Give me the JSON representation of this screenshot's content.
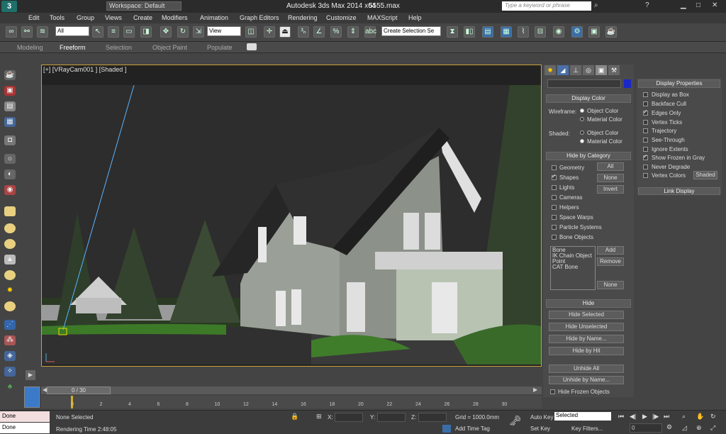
{
  "title": {
    "workspace": "Workspace: Default",
    "app": "Autodesk 3ds Max  2014 x64",
    "file": "5555.max",
    "search_placeholder": "Type a keyword or phrase"
  },
  "menu": [
    "Edit",
    "Tools",
    "Group",
    "Views",
    "Create",
    "Modifiers",
    "Animation",
    "Graph Editors",
    "Rendering",
    "Customize",
    "MAXScript",
    "Help"
  ],
  "toolbar": {
    "filter": "All",
    "view": "View",
    "selection_set": "Create Selection Se"
  },
  "ribbon": {
    "tabs": [
      "Modeling",
      "Freeform",
      "Selection",
      "Object Paint",
      "Populate"
    ]
  },
  "viewport": {
    "label": "[+] [VRayCam001 ] [Shaded ]"
  },
  "display_color": {
    "header": "Display Color",
    "wireframe": "Wireframe:",
    "shaded": "Shaded:",
    "object_color": "Object Color",
    "material_color": "Material Color"
  },
  "hide_by_category": {
    "header": "Hide by Category",
    "items": [
      "Geometry",
      "Shapes",
      "Lights",
      "Cameras",
      "Helpers",
      "Space Warps",
      "Particle Systems",
      "Bone Objects"
    ],
    "all": "All",
    "none": "None",
    "invert": "Invert",
    "list": [
      "Bone",
      "IK Chain Object",
      "Point",
      "CAT Bone"
    ],
    "add": "Add",
    "remove": "Remove",
    "none2": "None"
  },
  "hide": {
    "header": "Hide",
    "buttons": [
      "Hide Selected",
      "Hide Unselected",
      "Hide by Name...",
      "Hide by Hit",
      "Unhide All",
      "Unhide by Name..."
    ],
    "frozen": "Hide Frozen Objects"
  },
  "display_properties": {
    "header": "Display Properties",
    "items": [
      "Display as Box",
      "Backface Cull",
      "Edges Only",
      "Vertex Ticks",
      "Trajectory",
      "See-Through",
      "Ignore Extents",
      "Show Frozen in Gray",
      "Never Degrade",
      "Vertex Colors"
    ],
    "shaded_btn": "Shaded",
    "link_display": "Link Display"
  },
  "timeline": {
    "frame": "0 / 30",
    "ticks": [
      "0",
      "2",
      "4",
      "6",
      "8",
      "10",
      "12",
      "14",
      "16",
      "18",
      "20",
      "22",
      "24",
      "26",
      "28",
      "30"
    ]
  },
  "status": {
    "script_label": "Done",
    "script_value": "Done",
    "message": "None Selected",
    "rendering": "Rendering Time  2:48:05",
    "x": "X:",
    "y": "Y:",
    "z": "Z:",
    "grid": "Grid = 1000.0mm",
    "add_time_tag": "Add Time Tag",
    "auto_key": "Auto Key",
    "set_key": "Set Key",
    "key_mode": "Selected",
    "key_filters": "Key Filters...",
    "frame_value": "0"
  }
}
